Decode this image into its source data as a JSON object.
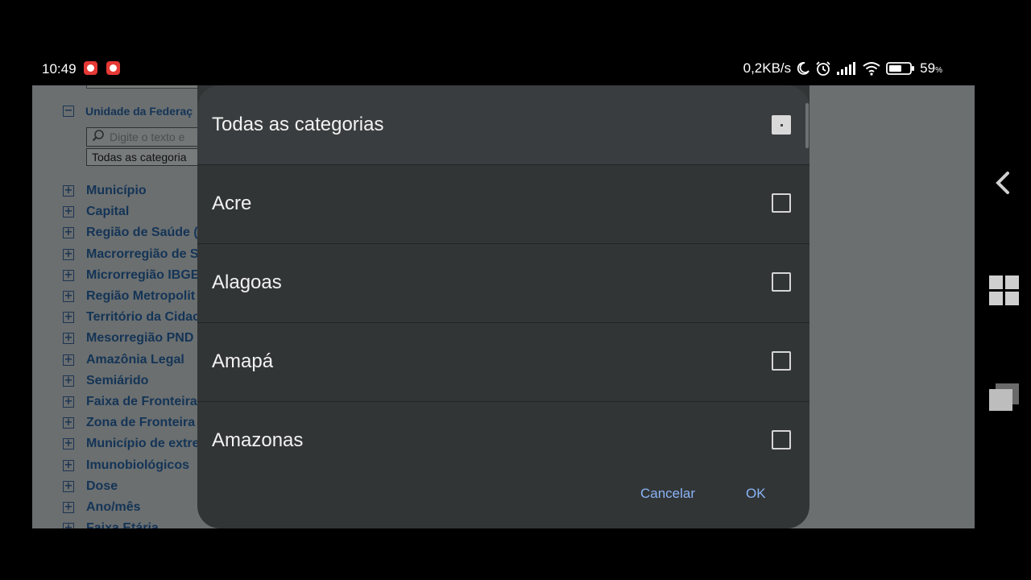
{
  "status_bar": {
    "time": "10:49",
    "net_speed": "0,2KB/s",
    "battery": "59",
    "battery_unit": "%",
    "icons": [
      "screen-record-icon",
      "screen-record-icon",
      "moon-icon",
      "alarm-icon",
      "signal-icon",
      "wifi-icon",
      "battery-icon"
    ]
  },
  "background_page": {
    "section_title": "Unidade da Federaç",
    "search_placeholder": "Digite o texto e",
    "select_value": "Todas as categoria",
    "items": [
      "Município",
      "Capital",
      "Região de Saúde (",
      "Macrorregião de S",
      "Microrregião IBGE",
      "Região Metropolit",
      "Território da Cidac",
      "Mesorregião PND",
      "Amazônia Legal",
      "Semiárido",
      "Faixa de Fronteira",
      "Zona de Fronteira",
      "Município de extre",
      "Imunobiológicos",
      "Dose",
      "Ano/mês",
      "Faixa Etária"
    ]
  },
  "dialog": {
    "header_label": "Todas as categorias",
    "header_checked": "indeterminate",
    "options": [
      {
        "label": "Acre",
        "checked": false
      },
      {
        "label": "Alagoas",
        "checked": false
      },
      {
        "label": "Amapá",
        "checked": false
      },
      {
        "label": "Amazonas",
        "checked": false
      }
    ],
    "cancel_label": "Cancelar",
    "ok_label": "OK"
  },
  "colors": {
    "dialog_bg": "#323536",
    "dialog_header_bg": "#3a3d3f",
    "accent": "#8ab4f8",
    "page_link": "#143456"
  }
}
